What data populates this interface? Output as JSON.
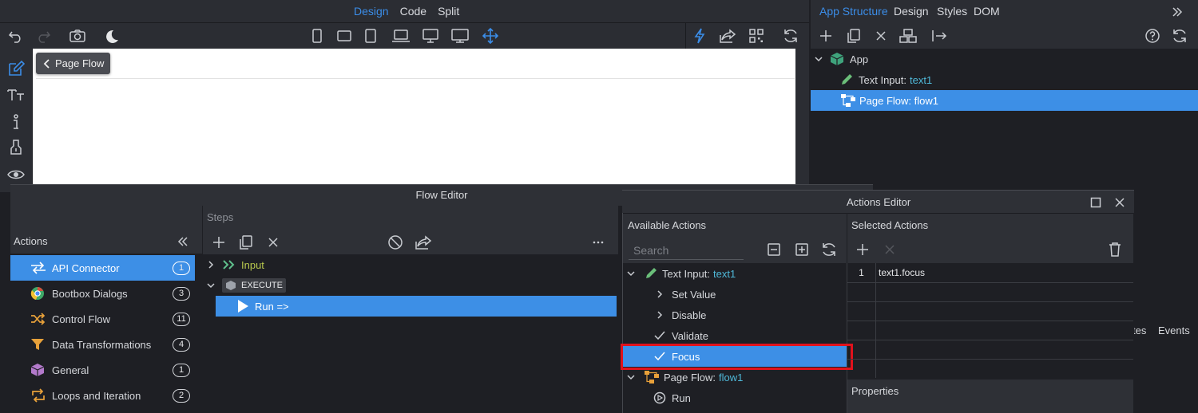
{
  "modes": [
    "Design",
    "Code",
    "Split"
  ],
  "active_mode": "Design",
  "canvas": {
    "back_button": "Page Flow"
  },
  "right_panel": {
    "tabs": [
      "App Structure",
      "Design",
      "Styles",
      "DOM"
    ],
    "active_tab": "App Structure",
    "tree": {
      "root": "App",
      "items": [
        {
          "label": "Text Input:",
          "id": "text1"
        },
        {
          "label": "Page Flow: flow1"
        }
      ]
    },
    "side_tabs": [
      "tes",
      "Events"
    ]
  },
  "flow_editor": {
    "title": "Flow Editor",
    "actions_header": "Actions",
    "actions": [
      {
        "label": "API Connector",
        "count": "1"
      },
      {
        "label": "Bootbox Dialogs",
        "count": "3"
      },
      {
        "label": "Control Flow",
        "count": "11"
      },
      {
        "label": "Data Transformations",
        "count": "4"
      },
      {
        "label": "General",
        "count": "1"
      },
      {
        "label": "Loops and Iteration",
        "count": "2"
      }
    ],
    "steps_header": "Steps",
    "steps": {
      "input": "Input",
      "execute": "EXECUTE",
      "run": "Run =>"
    }
  },
  "actions_editor": {
    "title": "Actions Editor",
    "available_header": "Available Actions",
    "selected_header": "Selected Actions",
    "search_placeholder": "Search",
    "available": {
      "text_input_label": "Text Input:",
      "text_input_id": "text1",
      "text_actions": [
        "Set Value",
        "Disable",
        "Validate",
        "Focus"
      ],
      "page_flow_label": "Page Flow:",
      "page_flow_id": "flow1",
      "page_flow_actions": [
        "Run"
      ]
    },
    "selected": [
      {
        "index": "1",
        "value": "text1.focus"
      }
    ],
    "properties_header": "Properties"
  }
}
